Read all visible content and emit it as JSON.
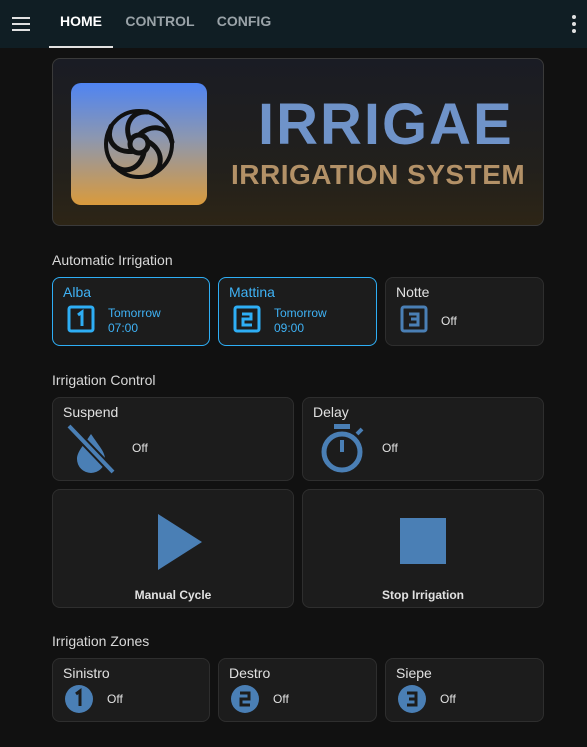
{
  "header": {
    "tabs": [
      {
        "label": "HOME",
        "active": true
      },
      {
        "label": "CONTROL",
        "active": false
      },
      {
        "label": "CONFIG",
        "active": false
      }
    ],
    "menu_icon": "hamburger-icon",
    "overflow_icon": "dots-vertical-icon"
  },
  "banner": {
    "title": "IRRIGAE",
    "subtitle": "IRRIGATION SYSTEM",
    "logo_icon": "fan-logo-icon"
  },
  "automatic": {
    "title": "Automatic Irrigation",
    "cards": [
      {
        "name": "Alba",
        "day": "Tomorrow",
        "time": "07:00",
        "number": "1",
        "selected": true
      },
      {
        "name": "Mattina",
        "day": "Tomorrow",
        "time": "09:00",
        "number": "2",
        "selected": true
      },
      {
        "name": "Notte",
        "state": "Off",
        "number": "3",
        "selected": false
      }
    ]
  },
  "control": {
    "title": "Irrigation Control",
    "suspend": {
      "label": "Suspend",
      "state": "Off",
      "icon": "water-off-icon"
    },
    "delay": {
      "label": "Delay",
      "state": "Off",
      "icon": "timer-icon"
    },
    "manual": {
      "label": "Manual Cycle",
      "icon": "play-icon"
    },
    "stop": {
      "label": "Stop Irrigation",
      "icon": "stop-icon"
    }
  },
  "zones": {
    "title": "Irrigation Zones",
    "items": [
      {
        "name": "Sinistro",
        "state": "Off",
        "number": "1"
      },
      {
        "name": "Destro",
        "state": "Off",
        "number": "2"
      },
      {
        "name": "Siepe",
        "state": "Off",
        "number": "3"
      }
    ]
  },
  "colors": {
    "accent": "#2eaef5",
    "icon_blue": "#4a7fb5",
    "topbar": "#101e24",
    "background": "#111111",
    "card": "#1c1c1c"
  }
}
